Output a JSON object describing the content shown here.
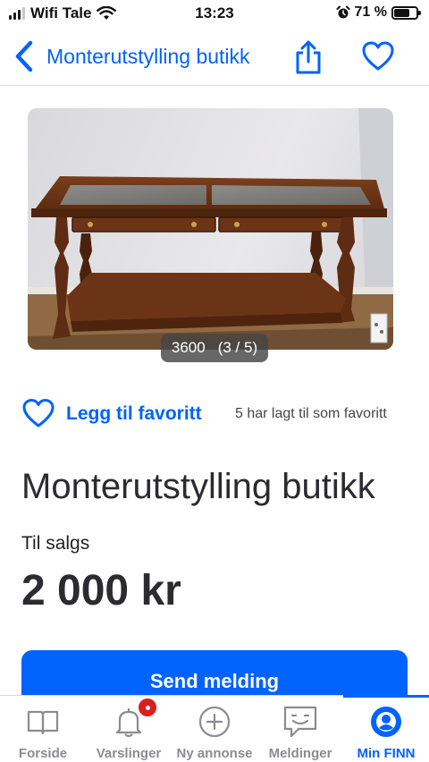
{
  "status_bar": {
    "carrier": "Wifi Tale",
    "time": "13:23",
    "battery": "71 %",
    "battery_level": 0.71
  },
  "nav": {
    "title": "Monterutstylling butikk",
    "back_icon": "chevron-left-icon",
    "share_icon": "share-icon",
    "favorite_icon": "heart-icon"
  },
  "image": {
    "counter_text": "3600",
    "counter_position": "(3 / 5)",
    "current": 3,
    "total": 5
  },
  "favorite": {
    "label": "Legg til favoritt",
    "count_text": "5 har lagt til som favoritt"
  },
  "ad": {
    "title": "Monterutstylling butikk",
    "type": "Til salgs",
    "price": "2 000 kr"
  },
  "actions": {
    "send_label": "Send melding"
  },
  "tab_bar": {
    "tabs": [
      {
        "label": "Forside",
        "icon": "book-icon",
        "active": false
      },
      {
        "label": "Varslinger",
        "icon": "bell-icon",
        "active": false
      },
      {
        "label": "Ny annonse",
        "icon": "plus-circle-icon",
        "active": false
      },
      {
        "label": "Meldinger",
        "icon": "chat-icon",
        "active": false
      },
      {
        "label": "Min FINN",
        "icon": "profile-icon",
        "active": true
      }
    ]
  },
  "colors": {
    "accent": "#0063fb",
    "text": "#2b2b30",
    "muted": "#8b8b92",
    "badge": "#d91f1f"
  }
}
